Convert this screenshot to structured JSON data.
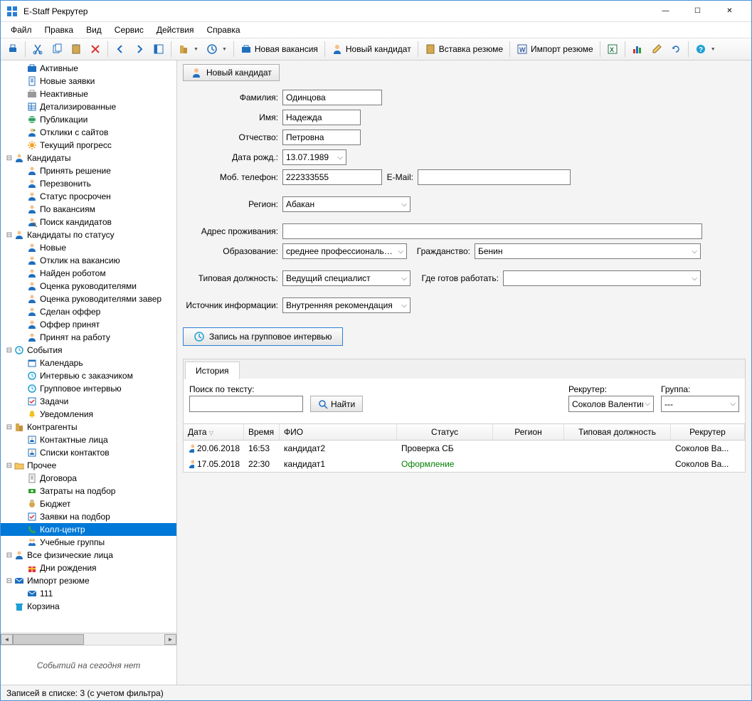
{
  "app": {
    "title": "E-Staff Рекрутер"
  },
  "menu": [
    "Файл",
    "Правка",
    "Вид",
    "Сервис",
    "Действия",
    "Справка"
  ],
  "toolbar": {
    "new_vacancy": "Новая вакансия",
    "new_candidate": "Новый кандидат",
    "paste_resume": "Вставка резюме",
    "import_resume": "Импорт резюме"
  },
  "tree": [
    {
      "lv": 2,
      "icon": "briefcase-blue",
      "label": "Активные"
    },
    {
      "lv": 2,
      "icon": "doc-blue",
      "label": "Новые заявки"
    },
    {
      "lv": 2,
      "icon": "briefcase-grey",
      "label": "Неактивные"
    },
    {
      "lv": 2,
      "icon": "doc-grid",
      "label": "Детализированные"
    },
    {
      "lv": 2,
      "icon": "globe",
      "label": "Публикации"
    },
    {
      "lv": 2,
      "icon": "person-reply",
      "label": "Отклики с сайтов"
    },
    {
      "lv": 2,
      "icon": "sun",
      "label": "Текущий прогресс"
    },
    {
      "lv": 1,
      "exp": "-",
      "icon": "person",
      "label": "Кандидаты"
    },
    {
      "lv": 2,
      "icon": "person",
      "label": "Принять решение"
    },
    {
      "lv": 2,
      "icon": "person",
      "label": "Перезвонить"
    },
    {
      "lv": 2,
      "icon": "person",
      "label": "Статус просрочен"
    },
    {
      "lv": 2,
      "icon": "person",
      "label": "По вакансиям"
    },
    {
      "lv": 2,
      "icon": "person-search",
      "label": "Поиск кандидатов"
    },
    {
      "lv": 1,
      "exp": "-",
      "icon": "person",
      "label": "Кандидаты по статусу"
    },
    {
      "lv": 2,
      "icon": "person",
      "label": "Новые"
    },
    {
      "lv": 2,
      "icon": "person",
      "label": "Отклик на вакансию"
    },
    {
      "lv": 2,
      "icon": "person",
      "label": "Найден роботом"
    },
    {
      "lv": 2,
      "icon": "person",
      "label": "Оценка руководителями"
    },
    {
      "lv": 2,
      "icon": "person",
      "label": "Оценка руководителями завер"
    },
    {
      "lv": 2,
      "icon": "person",
      "label": "Сделан оффер"
    },
    {
      "lv": 2,
      "icon": "person",
      "label": "Оффер принят"
    },
    {
      "lv": 2,
      "icon": "person",
      "label": "Принят на работу"
    },
    {
      "lv": 1,
      "exp": "-",
      "icon": "clock",
      "label": "События"
    },
    {
      "lv": 2,
      "icon": "calendar",
      "label": "Календарь"
    },
    {
      "lv": 2,
      "icon": "clock",
      "label": "Интервью с заказчиком"
    },
    {
      "lv": 2,
      "icon": "clock",
      "label": "Групповое интервью"
    },
    {
      "lv": 2,
      "icon": "check",
      "label": "Задачи"
    },
    {
      "lv": 2,
      "icon": "bell",
      "label": "Уведомления"
    },
    {
      "lv": 1,
      "exp": "-",
      "icon": "building",
      "label": "Контрагенты"
    },
    {
      "lv": 2,
      "icon": "contacts",
      "label": "Контактные лица"
    },
    {
      "lv": 2,
      "icon": "contacts",
      "label": "Списки контактов"
    },
    {
      "lv": 1,
      "exp": "-",
      "icon": "folder",
      "label": "Прочее"
    },
    {
      "lv": 2,
      "icon": "doc",
      "label": "Договора"
    },
    {
      "lv": 2,
      "icon": "money",
      "label": "Затраты на подбор"
    },
    {
      "lv": 2,
      "icon": "bag",
      "label": "Бюджет"
    },
    {
      "lv": 2,
      "icon": "check",
      "label": "Заявки на подбор"
    },
    {
      "lv": 2,
      "icon": "phone",
      "label": "Колл-центр",
      "selected": true
    },
    {
      "lv": 2,
      "icon": "group",
      "label": "Учебные группы"
    },
    {
      "lv": 1,
      "exp": "-",
      "icon": "person",
      "label": "Все физические лица"
    },
    {
      "lv": 2,
      "icon": "gift",
      "label": "Дни рождения"
    },
    {
      "lv": 1,
      "exp": "-",
      "icon": "mail",
      "label": "Импорт резюме"
    },
    {
      "lv": 2,
      "icon": "mail",
      "label": "111"
    },
    {
      "lv": 1,
      "exp": "",
      "icon": "trash",
      "label": "Корзина"
    }
  ],
  "tree_footer": "Событий на сегодня нет",
  "form": {
    "new_candidate_btn": "Новый кандидат",
    "surname_label": "Фамилия:",
    "surname": "Одинцова",
    "name_label": "Имя:",
    "name": "Надежда",
    "patronymic_label": "Отчество:",
    "patronymic": "Петровна",
    "dob_label": "Дата рожд.:",
    "dob": "13.07.1989",
    "mobile_label": "Моб. телефон:",
    "mobile": "222333555",
    "email_label": "E-Mail:",
    "email": "",
    "region_label": "Регион:",
    "region": "Абакан",
    "address_label": "Адрес проживания:",
    "address": "",
    "education_label": "Образование:",
    "education": "среднее профессиональное",
    "citizenship_label": "Гражданство:",
    "citizenship": "Бенин",
    "position_label": "Типовая должность:",
    "position": "Ведущий специалист",
    "work_location_label": "Где готов работать:",
    "work_location": "",
    "source_label": "Источник информации:",
    "source": "Внутренняя рекомендация",
    "group_interview_btn": "Запись на групповое интервью"
  },
  "history": {
    "tab": "История",
    "search_label": "Поиск по тексту:",
    "find_btn": "Найти",
    "recruiter_label": "Рекрутер:",
    "recruiter": "Соколов Валентин",
    "group_label": "Группа:",
    "group": "---",
    "columns": {
      "date": "Дата",
      "time": "Время",
      "fio": "ФИО",
      "status": "Статус",
      "region": "Регион",
      "position": "Типовая должность",
      "recruiter": "Рекрутер"
    },
    "rows": [
      {
        "date": "20.06.2018",
        "time": "16:53",
        "fio": "кандидат2",
        "status": "Проверка СБ",
        "status_color": "#000",
        "recruiter": "Соколов Ва..."
      },
      {
        "date": "17.05.2018",
        "time": "22:30",
        "fio": "кандидат1",
        "status": "Оформление",
        "status_color": "#008000",
        "recruiter": "Соколов Ва..."
      }
    ]
  },
  "statusbar": "Записей в списке: 3  (с учетом фильтра)"
}
